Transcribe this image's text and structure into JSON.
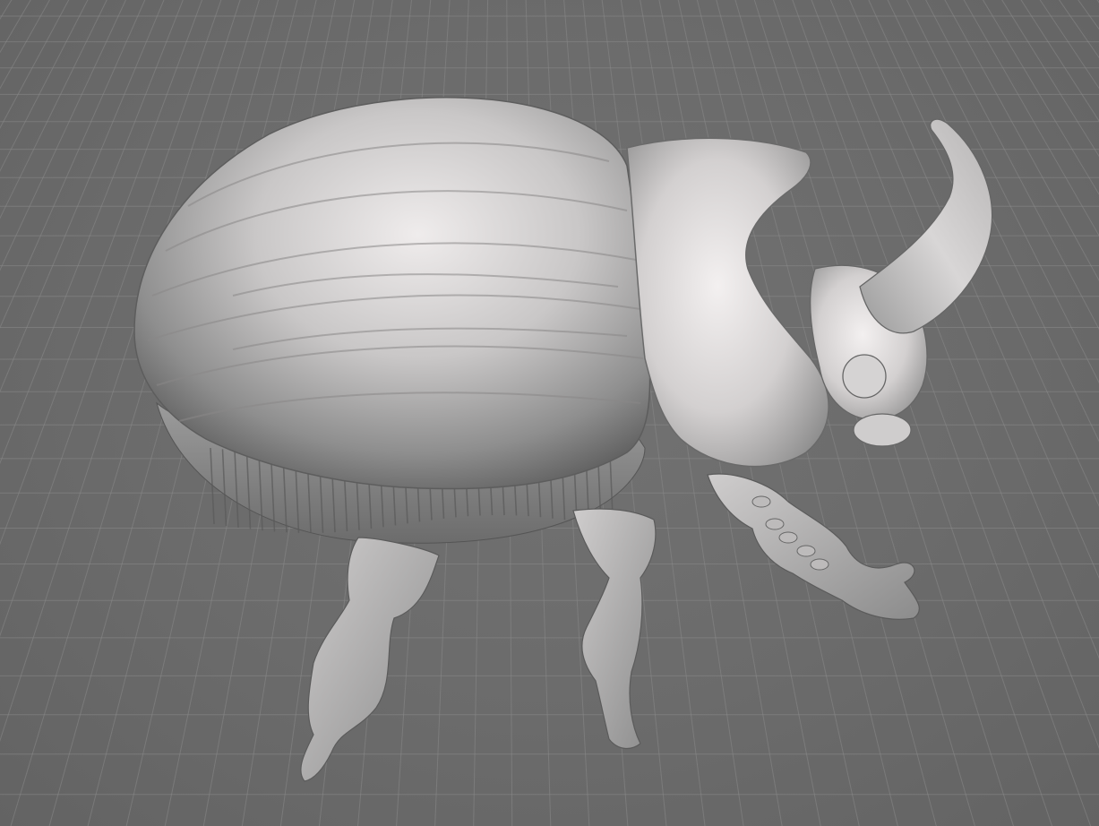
{
  "viewport": {
    "model": "rhinoceros-beetle-mesh",
    "grid": true,
    "colors": {
      "background": "#6a6a6a",
      "grid_line": "#8a8a8a",
      "grid_minor": "#7b7b7b",
      "model_light": "#e8e6e6",
      "model_mid": "#a9a9a9",
      "model_dark": "#5e5e5e"
    }
  }
}
